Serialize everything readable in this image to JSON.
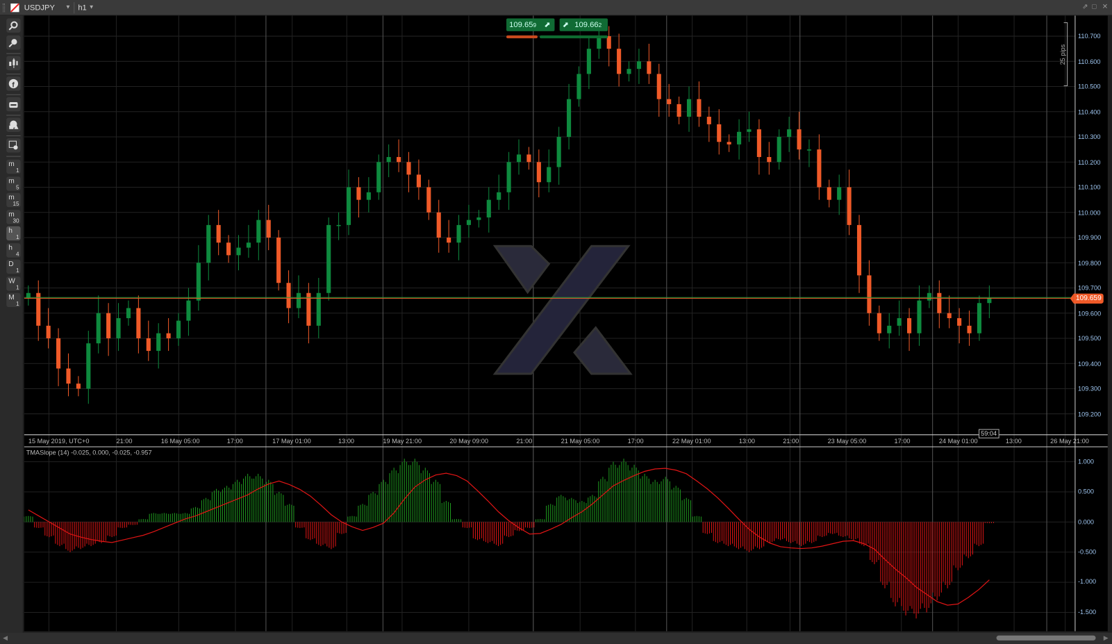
{
  "window": {
    "symbol": "USDJPY",
    "timeframe": "h1"
  },
  "toolbar": {
    "tools": [
      "zoom-in",
      "zoom-out",
      "chart-type",
      "facebook",
      "cbot",
      "draw-shapes",
      "chart-settings"
    ],
    "timeframes": [
      {
        "a": "m",
        "b": "1"
      },
      {
        "a": "m",
        "b": "5"
      },
      {
        "a": "m",
        "b": "15"
      },
      {
        "a": "m",
        "b": "30"
      },
      {
        "a": "h",
        "b": "1"
      },
      {
        "a": "h",
        "b": "4"
      },
      {
        "a": "D",
        "b": "1"
      },
      {
        "a": "W",
        "b": "1"
      },
      {
        "a": "M",
        "b": "1"
      }
    ],
    "active_timeframe": "h1"
  },
  "quote": {
    "sell": "109.65",
    "sell_pip": "9",
    "buy": "109.66",
    "buy_pip": "2",
    "spread_sell_fraction": 0.33
  },
  "current_price": "109.659",
  "candle_timer": "59:04",
  "pips_ruler": "25 pips",
  "price_axis": [
    "110.700",
    "110.600",
    "110.500",
    "110.400",
    "110.300",
    "110.200",
    "110.100",
    "110.000",
    "109.900",
    "109.800",
    "109.700",
    "109.600",
    "109.500",
    "109.400",
    "109.300",
    "109.200"
  ],
  "time_axis": [
    "15 May 2019, UTC+0",
    "21:00",
    "16 May 05:00",
    "17:00",
    "17 May 01:00",
    "13:00",
    "19 May 21:00",
    "20 May 09:00",
    "21:00",
    "21 May 05:00",
    "17:00",
    "22 May 01:00",
    "13:00",
    "21:00",
    "23 May 05:00",
    "17:00",
    "24 May 01:00",
    "13:00",
    "26 May 21:00"
  ],
  "indicator": {
    "label": "TMASlope (14) -0.025, 0.000, -0.025, -0.957",
    "axis": [
      "1.000",
      "0.500",
      "0.000",
      "-0.500",
      "-1.000",
      "-1.500"
    ]
  },
  "colors": {
    "bull": "#0e8a3e",
    "bear": "#f05a28",
    "hist_up": "#1f9a1f",
    "hist_down": "#e01515",
    "line": "#e01515",
    "ask_line": "#1a9a3a",
    "bid_line": "#f05a28"
  },
  "chart_data": {
    "type": "candlestick",
    "first_open": 109.66,
    "closes": [
      109.68,
      109.55,
      109.5,
      109.38,
      109.32,
      109.3,
      109.48,
      109.6,
      109.5,
      109.58,
      109.62,
      109.5,
      109.45,
      109.52,
      109.5,
      109.57,
      109.65,
      109.8,
      109.95,
      109.88,
      109.83,
      109.86,
      109.88,
      109.97,
      109.9,
      109.72,
      109.62,
      109.68,
      109.55,
      109.68,
      109.95,
      109.95,
      110.1,
      110.05,
      110.08,
      110.2,
      110.22,
      110.2,
      110.15,
      110.1,
      110.0,
      109.9,
      109.88,
      109.95,
      109.97,
      109.98,
      110.05,
      110.08,
      110.2,
      110.23,
      110.2,
      110.12,
      110.18,
      110.3,
      110.45,
      110.55,
      110.65,
      110.7,
      110.65,
      110.55,
      110.57,
      110.6,
      110.55,
      110.45,
      110.43,
      110.38,
      110.45,
      110.38,
      110.35,
      110.28,
      110.27,
      110.32,
      110.33,
      110.22,
      110.2,
      110.3,
      110.33,
      110.25,
      110.25,
      110.1,
      110.05,
      110.1,
      109.95,
      109.75,
      109.6,
      109.52,
      109.55,
      109.58,
      109.52,
      109.65,
      109.68,
      109.6,
      109.58,
      109.55,
      109.52,
      109.64,
      109.66
    ],
    "ylim": [
      109.12,
      110.76
    ],
    "indicator_hist": [
      0.1,
      -0.1,
      -0.25,
      -0.4,
      -0.5,
      -0.45,
      -0.4,
      -0.35,
      -0.25,
      -0.1,
      -0.05,
      0.05,
      0.15,
      0.15,
      0.15,
      0.15,
      0.25,
      0.4,
      0.55,
      0.6,
      0.7,
      0.8,
      0.8,
      0.7,
      0.5,
      0.3,
      -0.1,
      -0.3,
      -0.4,
      -0.45,
      -0.2,
      0.1,
      0.3,
      0.5,
      0.7,
      0.9,
      1.05,
      1.05,
      0.9,
      0.7,
      0.35,
      0.05,
      -0.1,
      -0.3,
      -0.35,
      -0.4,
      -0.25,
      -0.15,
      -0.1,
      0.05,
      0.3,
      0.45,
      0.4,
      0.35,
      0.45,
      0.75,
      1.0,
      1.05,
      0.95,
      0.8,
      0.7,
      0.75,
      0.6,
      0.4,
      0.1,
      -0.2,
      -0.35,
      -0.4,
      -0.45,
      -0.5,
      -0.45,
      -0.35,
      -0.3,
      -0.35,
      -0.4,
      -0.35,
      -0.25,
      -0.2,
      -0.25,
      -0.3,
      -0.4,
      -0.7,
      -1.1,
      -1.4,
      -1.55,
      -1.6,
      -1.5,
      -1.3,
      -1.1,
      -0.8,
      -0.6,
      -0.4,
      -0.02
    ],
    "indicator_line": [
      0.2,
      0.1,
      0.0,
      -0.1,
      -0.2,
      -0.25,
      -0.29,
      -0.32,
      -0.34,
      -0.3,
      -0.26,
      -0.22,
      -0.16,
      -0.09,
      -0.02,
      0.05,
      0.1,
      0.17,
      0.24,
      0.31,
      0.38,
      0.45,
      0.55,
      0.63,
      0.68,
      0.62,
      0.54,
      0.43,
      0.28,
      0.12,
      0.0,
      -0.08,
      -0.14,
      -0.09,
      -0.02,
      0.15,
      0.38,
      0.58,
      0.7,
      0.78,
      0.81,
      0.77,
      0.68,
      0.52,
      0.35,
      0.17,
      0.02,
      -0.1,
      -0.2,
      -0.19,
      -0.12,
      -0.04,
      0.07,
      0.17,
      0.3,
      0.45,
      0.6,
      0.69,
      0.77,
      0.84,
      0.88,
      0.89,
      0.86,
      0.8,
      0.68,
      0.55,
      0.4,
      0.23,
      0.05,
      -0.12,
      -0.25,
      -0.35,
      -0.41,
      -0.43,
      -0.44,
      -0.43,
      -0.4,
      -0.36,
      -0.32,
      -0.31,
      -0.36,
      -0.45,
      -0.62,
      -0.78,
      -0.92,
      -1.08,
      -1.2,
      -1.32,
      -1.38,
      -1.36,
      -1.25,
      -1.12,
      -0.96
    ],
    "indicator_ylim": [
      -1.7,
      1.2
    ]
  }
}
